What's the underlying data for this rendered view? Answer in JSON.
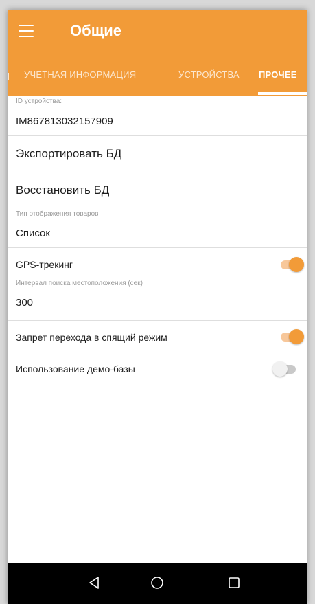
{
  "appbar": {
    "title": "Общие",
    "menu_icon": "hamburger-menu-icon",
    "color": "#f29b38"
  },
  "tabs": [
    {
      "label": "УЧЕТНАЯ ИНФОРМАЦИЯ",
      "active": false
    },
    {
      "label": "УСТРОЙСТВА",
      "active": false
    },
    {
      "label": "ПРОЧЕЕ",
      "active": true
    }
  ],
  "settings": {
    "device_id": {
      "caption": "ID устройства:",
      "value": "IM867813032157909"
    },
    "export_db": {
      "label": "Экспортировать БД"
    },
    "restore_db": {
      "label": "Восстановить БД"
    },
    "display_type": {
      "caption": "Тип отображения товаров",
      "value": "Список"
    },
    "gps_tracking": {
      "label": "GPS-трекинг",
      "enabled": true
    },
    "location_interval": {
      "caption": "Интервал поиска местоположения (сек)",
      "value": "300"
    },
    "sleep_block": {
      "label": "Запрет перехода в спящий режим",
      "enabled": true
    },
    "demo_db": {
      "label": "Использование демо-базы",
      "enabled": false
    }
  },
  "navbar": {
    "buttons": [
      "back-icon",
      "home-icon",
      "recents-icon"
    ]
  }
}
